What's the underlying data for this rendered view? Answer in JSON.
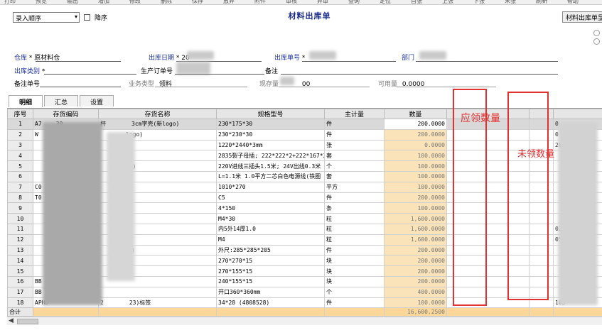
{
  "toolbar": {
    "items": [
      "打印",
      "预览",
      "输出",
      "增加",
      "修改",
      "删除",
      "保存",
      "放弃",
      "附件",
      "审核",
      "弃审",
      "查询",
      "定位",
      "首张",
      "上张",
      "下张",
      "末张",
      "刷新",
      "帮助"
    ]
  },
  "sort": {
    "selected": "录入顺序",
    "desc_label": "降序"
  },
  "title": "材料出库单",
  "right_button": "材料出库单显",
  "header": {
    "warehouse_label": "仓库",
    "warehouse_value": "原材料仓",
    "date_label": "出库日期",
    "date_value": "20",
    "no_label": "出库单号",
    "dept_label": "部门",
    "category_label": "出库类别",
    "order_label": "生产订单号",
    "remark_label": "备注",
    "remark_no_label": "备注单号",
    "biz_type_label": "业务类型",
    "biz_type_value": "领料",
    "stock_label": "现存量",
    "stock_value": "00",
    "available_label": "可用量",
    "available_value": "0.0000"
  },
  "tabs": [
    "明细",
    "汇总",
    "设置"
  ],
  "columns": [
    "序号",
    "存货编码",
    "存货名称",
    "规格型号",
    "主计量",
    "数量",
    "",
    "",
    ""
  ],
  "rows": [
    {
      "seq": "1",
      "code": "A7",
      "cpart": "30",
      "name": "杯",
      "npart": "3cm字壳(新logo)",
      "spec": "230*175*30",
      "unit": "件",
      "qty": "200.0000",
      "tail": "0"
    },
    {
      "seq": "2",
      "code": "W",
      "cpart": "",
      "name": "",
      "npart": "logo)",
      "spec": "230*230*30",
      "unit": "件",
      "qty": "200.0000",
      "tail": "0"
    },
    {
      "seq": "3",
      "code": "",
      "cpart": "017",
      "name": "",
      "npart": "",
      "spec": "1220*2440*3mm",
      "unit": "张",
      "qty": "0.0000",
      "tail": "28105"
    },
    {
      "seq": "4",
      "code": "",
      "cpart": "49",
      "name": "",
      "npart": "4V",
      "spec": "2835裂子母插; 222*222*2+222*167*2",
      "unit": "套",
      "qty": "100.0000",
      "tail": ""
    },
    {
      "seq": "5",
      "code": "",
      "cpart": "1",
      "name": "",
      "npart": "4A)",
      "spec": "220V进线三插头1.5米; 24V出线0.3米",
      "unit": "个",
      "qty": "100.0000",
      "tail": ""
    },
    {
      "seq": "6",
      "code": "",
      "cpart": "0",
      "name": "",
      "npart": "",
      "spec": "L=1.1米 1.0平方二芯白色电源线(铁圈",
      "unit": "套",
      "qty": "100.0000",
      "tail": ""
    },
    {
      "seq": "7",
      "code": "C0",
      "cpart": "",
      "name": "",
      "npart": "",
      "spec": "1010*270",
      "unit": "平方",
      "qty": "100.0000",
      "tail": ""
    },
    {
      "seq": "8",
      "code": "T0",
      "cpart": "",
      "name": "",
      "npart": "",
      "spec": "C5",
      "unit": "件",
      "qty": "200.0000",
      "tail": ""
    },
    {
      "seq": "9",
      "code": "",
      "cpart": "0",
      "name": "",
      "npart": "",
      "spec": "4*150",
      "unit": "条",
      "qty": "100.0000",
      "tail": ""
    },
    {
      "seq": "10",
      "code": "",
      "cpart": "",
      "name": "",
      "npart": "",
      "spec": "M4*30",
      "unit": "粒",
      "qty": "1,600.0000",
      "tail": ""
    },
    {
      "seq": "11",
      "code": "",
      "cpart": "",
      "name": "",
      "npart": "",
      "spec": "内5外14厚1.0",
      "unit": "粒",
      "qty": "1,600.0000",
      "tail": "02"
    },
    {
      "seq": "12",
      "code": "",
      "cpart": "",
      "name": "",
      "npart": "",
      "spec": "M4",
      "unit": "粒",
      "qty": "1,600.0000",
      "tail": "05"
    },
    {
      "seq": "13",
      "code": "",
      "cpart": "",
      "name": "",
      "npart": "瑚)",
      "spec": "外尺:285*285*205",
      "unit": "件",
      "qty": "200.0000",
      "tail": ""
    },
    {
      "seq": "14",
      "code": "",
      "cpart": "",
      "name": "",
      "npart": "",
      "spec": "270*270*15",
      "unit": "块",
      "qty": "200.0000",
      "tail": ""
    },
    {
      "seq": "15",
      "code": "",
      "cpart": "",
      "name": "",
      "npart": "",
      "spec": "270*155*15",
      "unit": "块",
      "qty": "200.0000",
      "tail": ""
    },
    {
      "seq": "16",
      "code": "BB",
      "cpart": "",
      "name": "",
      "npart": "",
      "spec": "240*155*15",
      "unit": "块",
      "qty": "200.0000",
      "tail": ""
    },
    {
      "seq": "17",
      "code": "BB",
      "cpart": "",
      "name": "",
      "npart": "",
      "spec": "开口360*360mm",
      "unit": "个",
      "qty": "400.0000",
      "tail": ""
    },
    {
      "seq": "18",
      "code": "APHD",
      "cpart": "",
      "name": "2",
      "npart": "23)标签",
      "spec": "34*28 (4808528)",
      "unit": "件",
      "qty": "100.0000",
      "tail": "105"
    }
  ],
  "total": {
    "label": "合计",
    "qty": "16,600.2500"
  },
  "annotations": {
    "should_qty": "应领数量",
    "not_qty": "未领数量"
  }
}
